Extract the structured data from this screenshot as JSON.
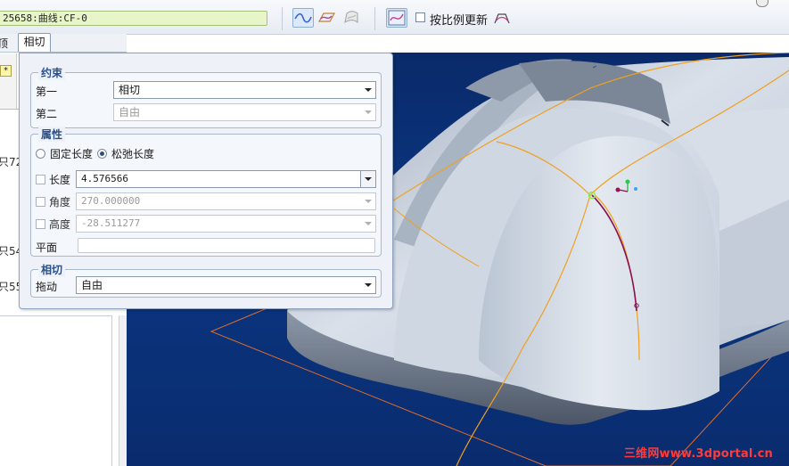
{
  "toolbar": {
    "curve_field": "25658:曲线:CF-0",
    "ratio_update_label": "按比例更新",
    "icons": [
      "tangent-curve-icon",
      "plane-curve-icon",
      "surface-curve-icon",
      "curvature-icon",
      "ratio-checkbox",
      "control-polygon-icon",
      "help-icon"
    ]
  },
  "tabs": {
    "left_fragment": "顶",
    "tangent": "相切"
  },
  "left_panel": {
    "star_badge": "*",
    "fragments": [
      "只72",
      "只54",
      "只55"
    ]
  },
  "dialog": {
    "constraint_group": {
      "title": "约束",
      "first_label": "第一",
      "first_value": "相切",
      "second_label": "第二",
      "second_value": "自由"
    },
    "attribute_group": {
      "title": "属性",
      "fixed_length_label": "固定长度",
      "relaxed_length_label": "松弛长度",
      "length_label": "长度",
      "length_value": "4.576566",
      "angle_label": "角度",
      "angle_value": "270.000000",
      "height_label": "高度",
      "height_value": "-28.511277",
      "plane_label": "平面",
      "plane_value": ""
    },
    "tangent_group": {
      "title": "相切",
      "drag_label": "拖动",
      "drag_value": "自由"
    }
  },
  "viewport": {
    "watermark": "三维网www.3dportal.cn",
    "colors": {
      "background": "#0b3682",
      "model": "#c9d2de",
      "curves": "#f0a020",
      "active_curve": "#8a1050"
    }
  }
}
